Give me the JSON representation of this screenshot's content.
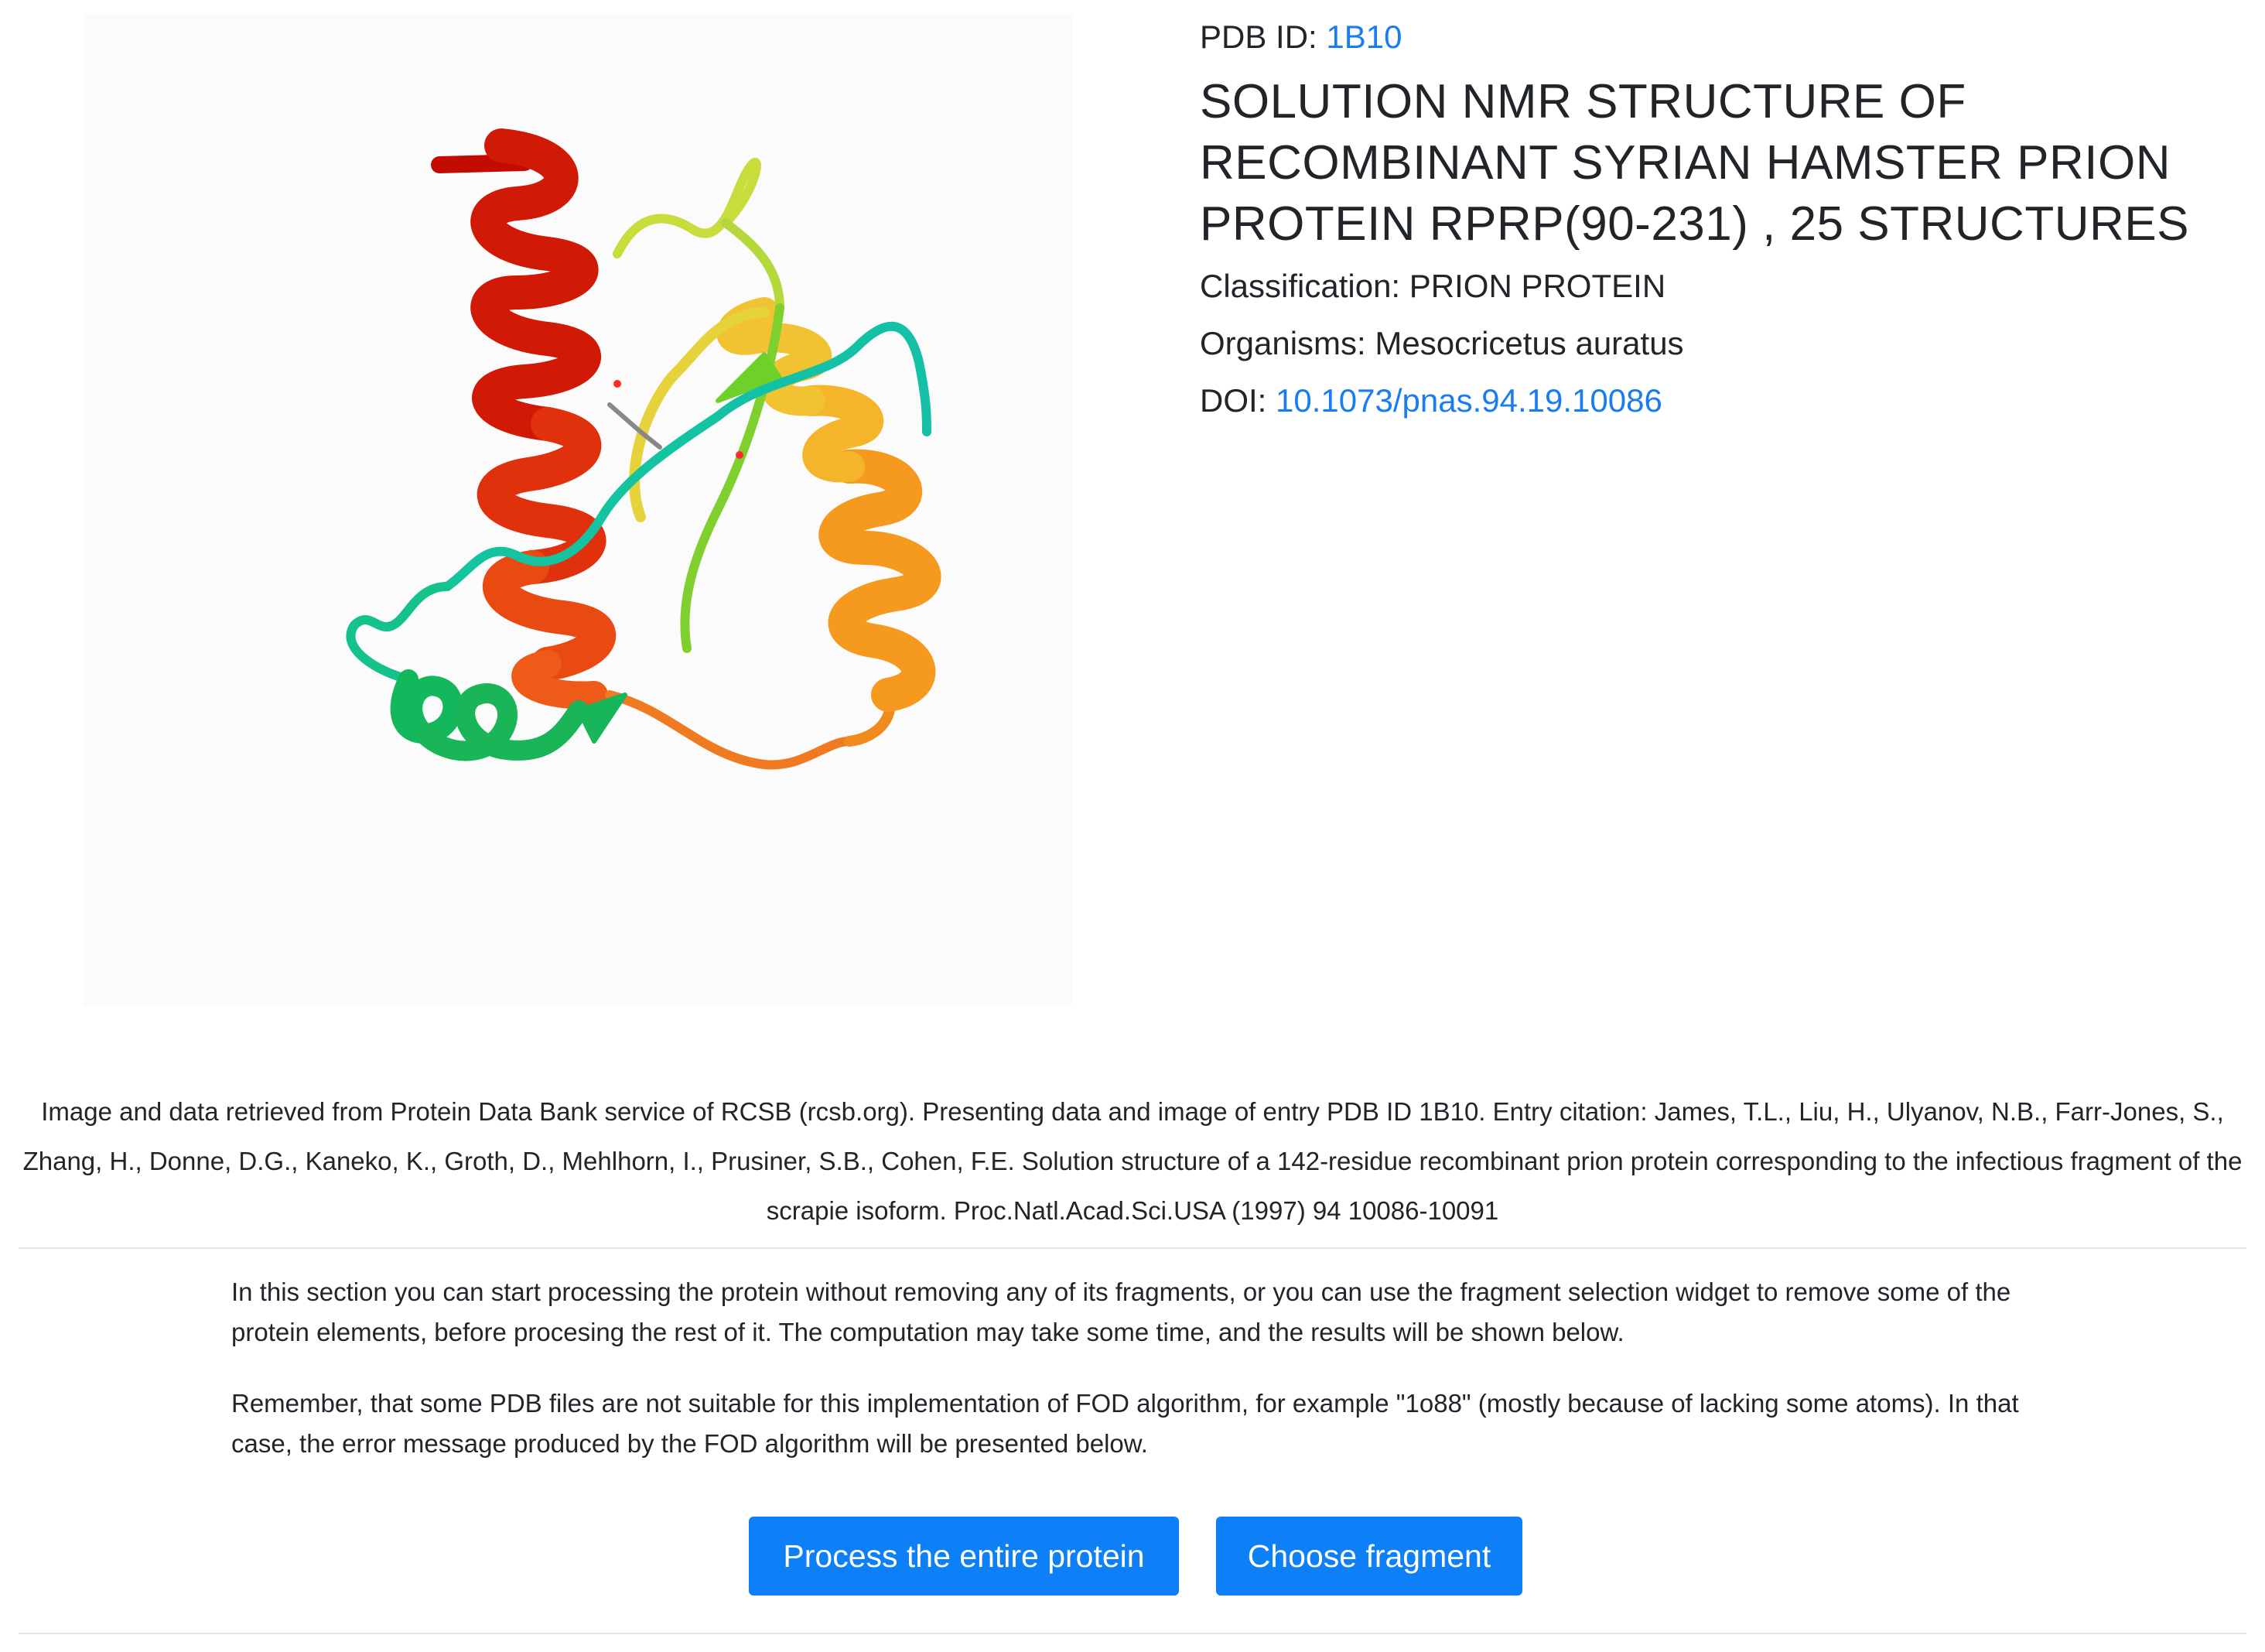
{
  "entry": {
    "pdb_id_label": "PDB ID:",
    "pdb_id": "1B10",
    "title": "SOLUTION NMR STRUCTURE OF RECOMBINANT SYRIAN HAMSTER PRION PROTEIN RPRP(90-231) , 25 STRUCTURES",
    "classification_label": "Classification:",
    "classification": "PRION PROTEIN",
    "organisms_label": "Organisms:",
    "organisms": "Mesocricetus auratus",
    "doi_label": "DOI:",
    "doi": "10.1073/pnas.94.19.10086"
  },
  "structure_image": {
    "description_icon": "protein-ribbon-structure",
    "colors": [
      "#c40b00",
      "#e83a10",
      "#f2861a",
      "#f1c232",
      "#c8dc3c",
      "#6fd02a",
      "#12b85b",
      "#12bfa0"
    ]
  },
  "citation": "Image and data retrieved from Protein Data Bank service of RCSB (rcsb.org). Presenting data and image of entry PDB ID 1B10. Entry citation: James, T.L., Liu, H., Ulyanov, N.B., Farr-Jones, S., Zhang, H., Donne, D.G., Kaneko, K., Groth, D., Mehlhorn, I., Prusiner, S.B., Cohen, F.E. Solution structure of a 142-residue recombinant prion protein corresponding to the infectious fragment of the scrapie isoform. Proc.Natl.Acad.Sci.USA (1997) 94 10086-10091",
  "processing": {
    "intro": "In this section you can start processing the protein without removing any of its fragments, or you can use the fragment selection widget to remove some of the protein elements, before procesing the rest of it. The computation may take some time, and the results will be shown below.",
    "warning": "Remember, that some PDB files are not suitable for this implementation of FOD algorithm, for example \"1o88\" (mostly because of lacking some atoms). In that case, the error message produced by the FOD algorithm will be presented below.",
    "process_button": "Process the entire protein",
    "fragment_button": "Choose fragment"
  },
  "colors": {
    "link": "#1a7cf3",
    "button": "#0d7ff7",
    "button_text": "#ffffff"
  }
}
